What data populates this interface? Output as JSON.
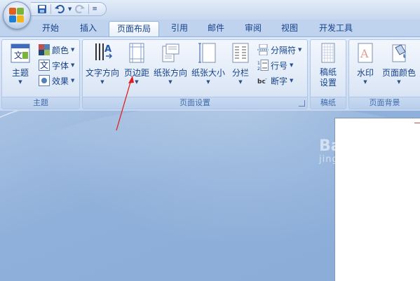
{
  "tabs": [
    "开始",
    "插入",
    "页面布局",
    "引用",
    "邮件",
    "审阅",
    "视图",
    "开发工具"
  ],
  "active_tab": "页面布局",
  "groups": {
    "theme": {
      "label": "主题",
      "theme_button": "主题",
      "colors": "颜色",
      "fonts": "字体",
      "effects": "效果"
    },
    "page_setup": {
      "label": "页面设置",
      "text_direction": "文字方向",
      "margins": "页边距",
      "orientation": "纸张方向",
      "size": "纸张大小",
      "columns": "分栏",
      "breaks": "分隔符",
      "line_numbers": "行号",
      "hyphenation": "断字"
    },
    "manuscript": {
      "label": "稿纸",
      "settings": "稿纸设置"
    },
    "background": {
      "label": "页面背景",
      "watermark": "水印",
      "page_color": "页面颜色"
    }
  },
  "watermark_text": {
    "main": "Bai 经验",
    "sub": "jingyan.baidu.com"
  },
  "colors": {
    "arrow": "#e02020",
    "accent": "#15428b"
  },
  "icons": [
    "office-button-icon",
    "save-icon",
    "undo-icon",
    "redo-icon",
    "customize-qat-icon"
  ]
}
